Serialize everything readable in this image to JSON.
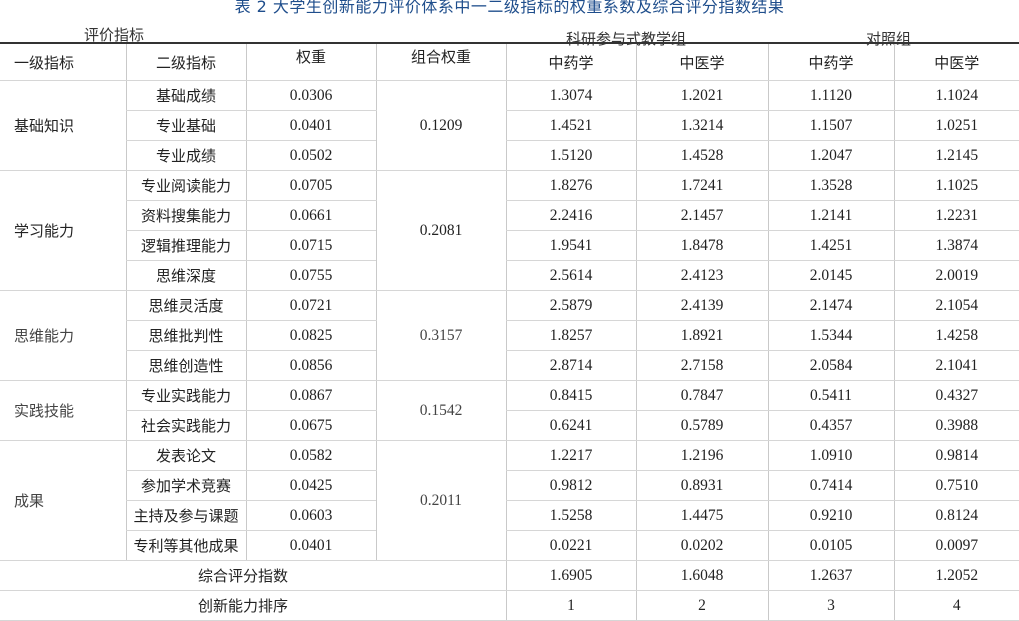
{
  "caption": "表 2 大学生创新能力评价体系中一二级指标的权重系数及综合评分指数结果",
  "header": {
    "eval_index": "评价指标",
    "level1": "一级指标",
    "level2": "二级指标",
    "weight": "权重",
    "combined_weight": "组合权重",
    "group_research": "科研参与式教学组",
    "group_control": "对照组",
    "tcm_pharmacy": "中药学",
    "tcm_medicine": "中医学"
  },
  "groups": [
    {
      "name": "基础知识",
      "combined": "0.1209"
    },
    {
      "name": "学习能力",
      "combined": "0.2081"
    },
    {
      "name": "思维能力",
      "combined": "0.3157"
    },
    {
      "name": "实践技能",
      "combined": "0.1542"
    },
    {
      "name": "成果",
      "combined": "0.2011"
    }
  ],
  "rows": [
    {
      "l2": "基础成绩",
      "w": "0.0306",
      "a": "1.3074",
      "b": "1.2021",
      "c": "1.1120",
      "d": "1.1024"
    },
    {
      "l2": "专业基础",
      "w": "0.0401",
      "a": "1.4521",
      "b": "1.3214",
      "c": "1.1507",
      "d": "1.0251"
    },
    {
      "l2": "专业成绩",
      "w": "0.0502",
      "a": "1.5120",
      "b": "1.4528",
      "c": "1.2047",
      "d": "1.2145"
    },
    {
      "l2": "专业阅读能力",
      "w": "0.0705",
      "a": "1.8276",
      "b": "1.7241",
      "c": "1.3528",
      "d": "1.1025"
    },
    {
      "l2": "资料搜集能力",
      "w": "0.0661",
      "a": "2.2416",
      "b": "2.1457",
      "c": "1.2141",
      "d": "1.2231"
    },
    {
      "l2": "逻辑推理能力",
      "w": "0.0715",
      "a": "1.9541",
      "b": "1.8478",
      "c": "1.4251",
      "d": "1.3874"
    },
    {
      "l2": "思维深度",
      "w": "0.0755",
      "a": "2.5614",
      "b": "2.4123",
      "c": "2.0145",
      "d": "2.0019"
    },
    {
      "l2": "思维灵活度",
      "w": "0.0721",
      "a": "2.5879",
      "b": "2.4139",
      "c": "2.1474",
      "d": "2.1054"
    },
    {
      "l2": "思维批判性",
      "w": "0.0825",
      "a": "1.8257",
      "b": "1.8921",
      "c": "1.5344",
      "d": "1.4258"
    },
    {
      "l2": "思维创造性",
      "w": "0.0856",
      "a": "2.8714",
      "b": "2.7158",
      "c": "2.0584",
      "d": "2.1041"
    },
    {
      "l2": "专业实践能力",
      "w": "0.0867",
      "a": "0.8415",
      "b": "0.7847",
      "c": "0.5411",
      "d": "0.4327"
    },
    {
      "l2": "社会实践能力",
      "w": "0.0675",
      "a": "0.6241",
      "b": "0.5789",
      "c": "0.4357",
      "d": "0.3988"
    },
    {
      "l2": "发表论文",
      "w": "0.0582",
      "a": "1.2217",
      "b": "1.2196",
      "c": "1.0910",
      "d": "0.9814"
    },
    {
      "l2": "参加学术竞赛",
      "w": "0.0425",
      "a": "0.9812",
      "b": "0.8931",
      "c": "0.7414",
      "d": "0.7510"
    },
    {
      "l2": "主持及参与课题",
      "w": "0.0603",
      "a": "1.5258",
      "b": "1.4475",
      "c": "0.9210",
      "d": "0.8124"
    },
    {
      "l2": "专利等其他成果",
      "w": "0.0401",
      "a": "0.0221",
      "b": "0.0202",
      "c": "0.0105",
      "d": "0.0097"
    }
  ],
  "summary": [
    {
      "label": "综合评分指数",
      "a": "1.6905",
      "b": "1.6048",
      "c": "1.2637",
      "d": "1.2052"
    },
    {
      "label": "创新能力排序",
      "a": "1",
      "b": "2",
      "c": "3",
      "d": "4"
    }
  ]
}
